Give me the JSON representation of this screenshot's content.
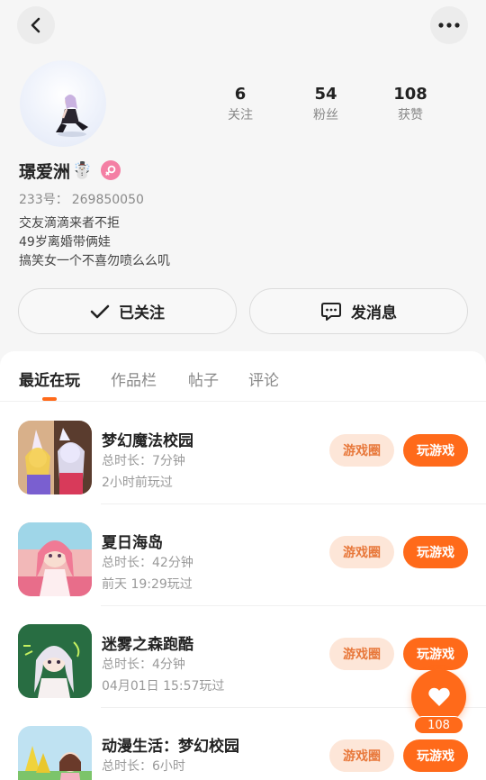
{
  "header": {
    "back_icon": "chevron-left-icon",
    "more_icon": "more-horizontal-icon"
  },
  "profile": {
    "name": "璟爱洲",
    "name_emoji": "☃️",
    "gender_icon": "female-icon",
    "uid_label": "233号：",
    "uid": "269850050",
    "bio": [
      "交友滴滴来者不拒",
      "49岁离婚带俩娃",
      "搞笑女一个不喜勿喷么么叽"
    ]
  },
  "stats": [
    {
      "value": "6",
      "label": "关注"
    },
    {
      "value": "54",
      "label": "粉丝"
    },
    {
      "value": "108",
      "label": "获赞"
    }
  ],
  "actions": {
    "follow_label": "已关注",
    "message_label": "发消息"
  },
  "tabs": [
    {
      "label": "最近在玩",
      "active": true
    },
    {
      "label": "作品栏",
      "active": false
    },
    {
      "label": "帖子",
      "active": false
    },
    {
      "label": "评论",
      "active": false
    }
  ],
  "games": [
    {
      "title": "梦幻魔法校园",
      "duration": "总时长：7分钟",
      "last_played": "2小时前玩过",
      "circle_label": "游戏圈",
      "play_label": "玩游戏"
    },
    {
      "title": "夏日海岛",
      "duration": "总时长：42分钟",
      "last_played": "前天 19:29玩过",
      "circle_label": "游戏圈",
      "play_label": "玩游戏"
    },
    {
      "title": "迷雾之森跑酷",
      "duration": "总时长：4分钟",
      "last_played": "04月01日 15:57玩过",
      "circle_label": "游戏圈",
      "play_label": "玩游戏"
    },
    {
      "title": "动漫生活：梦幻校园",
      "duration": "总时长：6小时",
      "last_played": "",
      "circle_label": "游戏圈",
      "play_label": "玩游戏"
    }
  ],
  "like_fab": {
    "icon": "heart-icon",
    "count": "108"
  },
  "colors": {
    "accent": "#ff6a1a",
    "accent_light": "#fde6d8",
    "gender_pink": "#f47fa4"
  }
}
